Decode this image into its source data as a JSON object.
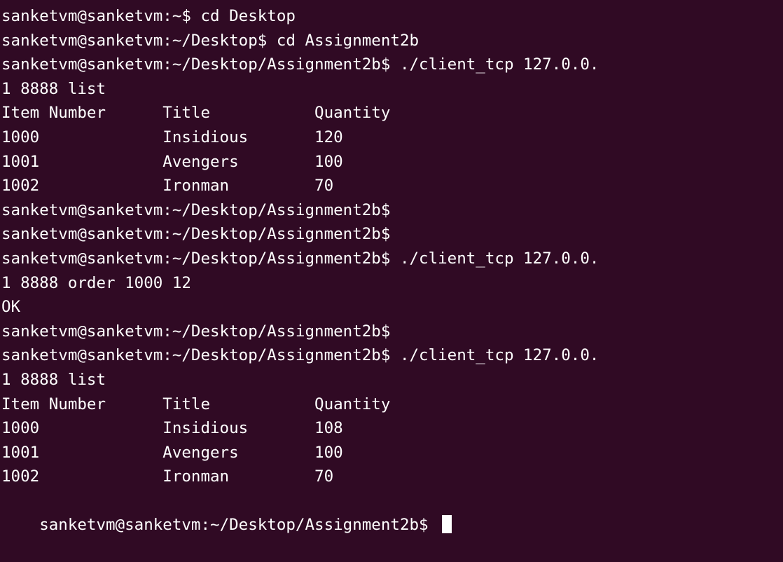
{
  "terminal": {
    "background_color": "#300a24",
    "text_color": "#ffffff",
    "lines": [
      "sanketvm@sanketvm:~$ cd Desktop",
      "sanketvm@sanketvm:~/Desktop$ cd Assignment2b",
      "sanketvm@sanketvm:~/Desktop/Assignment2b$ ./client_tcp 127.0.0.",
      "1 8888 list",
      "Item Number      Title           Quantity",
      "1000             Insidious       120",
      "1001             Avengers        100",
      "1002             Ironman         70",
      "sanketvm@sanketvm:~/Desktop/Assignment2b$",
      "sanketvm@sanketvm:~/Desktop/Assignment2b$",
      "sanketvm@sanketvm:~/Desktop/Assignment2b$ ./client_tcp 127.0.0.",
      "1 8888 order 1000 12",
      "OK",
      "sanketvm@sanketvm:~/Desktop/Assignment2b$",
      "sanketvm@sanketvm:~/Desktop/Assignment2b$ ./client_tcp 127.0.0.",
      "1 8888 list",
      "Item Number      Title           Quantity",
      "1000             Insidious       108",
      "1001             Avengers        100",
      "1002             Ironman         70"
    ],
    "prompt_line": "sanketvm@sanketvm:~/Desktop/Assignment2b$ "
  }
}
